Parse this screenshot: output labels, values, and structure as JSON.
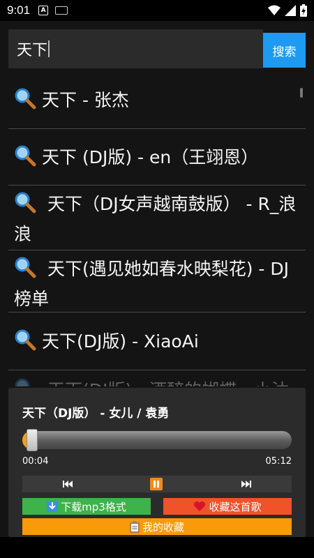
{
  "status": {
    "time": "9:01",
    "notif_letter": "A"
  },
  "search": {
    "query": "天下",
    "button_label": "搜索"
  },
  "results": [
    {
      "label": "天下 - 张杰"
    },
    {
      "label": "天下 (DJ版) - en（王翊恩）"
    },
    {
      "label": "天下（DJ女声越南鼓版） - R_浪浪"
    },
    {
      "label": "天下(遇见她如春水映梨花) - DJ榜单"
    },
    {
      "label": "天下(DJ版) - XiaoAi"
    },
    {
      "label": "天下(DJ版) - 酒醉的蝴蝶 - 小沐"
    }
  ],
  "player": {
    "title": "天下（DJ版） - 女儿 / 袁勇",
    "current_time": "00:04",
    "total_time": "05:12",
    "progress": 0.013,
    "download_label": "下载mp3格式",
    "favorite_label": "收藏这首歌",
    "my_favorites_label": "我的收藏"
  },
  "colors": {
    "accent_blue": "#1e9af0",
    "download_green": "#3db34a",
    "favorite_red": "#f0522a",
    "my_fav_orange": "#fb9a08",
    "play_orange": "#f08a20"
  },
  "icons": {
    "result": "magnifier-icon",
    "prev": "skip-previous-icon",
    "pause": "pause-icon",
    "next": "skip-next-icon",
    "download": "download-arrow-icon",
    "favorite": "heart-icon",
    "my_favorites": "clipboard-icon"
  }
}
